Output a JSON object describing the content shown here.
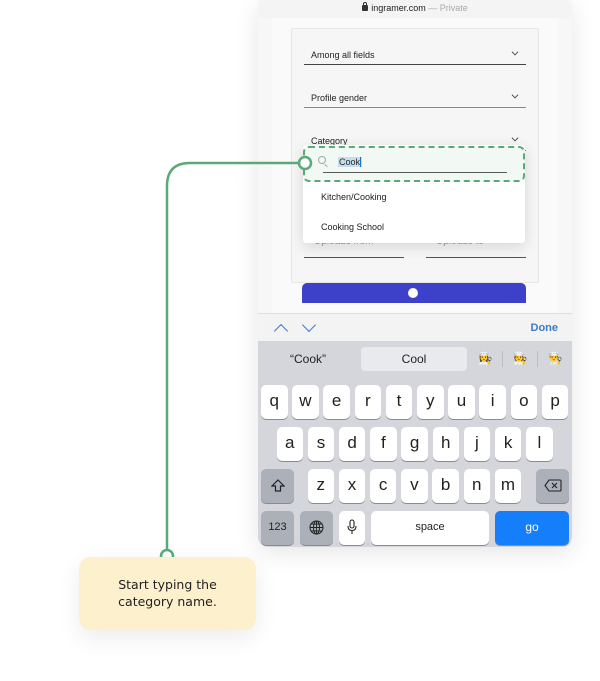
{
  "browser": {
    "domain": "ingramer.com",
    "separator": " — ",
    "mode": "Private"
  },
  "form": {
    "fields": [
      {
        "label": "Among all fields"
      },
      {
        "label": "Profile gender"
      },
      {
        "label": "Category"
      }
    ],
    "uploads_from_placeholder": "Uploads from",
    "uploads_to_placeholder": "Uploads to"
  },
  "dropdown": {
    "search_value": "Cook",
    "options": [
      "Kitchen/Cooking",
      "Cooking School"
    ]
  },
  "keyboard_toolbar": {
    "done_label": "Done"
  },
  "keyboard": {
    "suggestions": [
      "“Cook”",
      "Cool"
    ],
    "emoji_suggestions": [
      "👩‍🍳",
      "🧑‍🍳",
      "👨‍🍳"
    ],
    "row1": [
      "q",
      "w",
      "e",
      "r",
      "t",
      "y",
      "u",
      "i",
      "o",
      "p"
    ],
    "row2": [
      "a",
      "s",
      "d",
      "f",
      "g",
      "h",
      "j",
      "k",
      "l"
    ],
    "row3": [
      "z",
      "x",
      "c",
      "v",
      "b",
      "n",
      "m"
    ],
    "numbers_label": "123",
    "space_label": "space",
    "go_label": "go"
  },
  "callout": {
    "line1": "Start typing the",
    "line2": "category name."
  },
  "colors": {
    "accent_green": "#5aaa78",
    "callout_bg": "#fdf0cc",
    "go_blue": "#147efb",
    "link_blue": "#3a7bc8",
    "submit_indigo": "#3d40c8"
  }
}
